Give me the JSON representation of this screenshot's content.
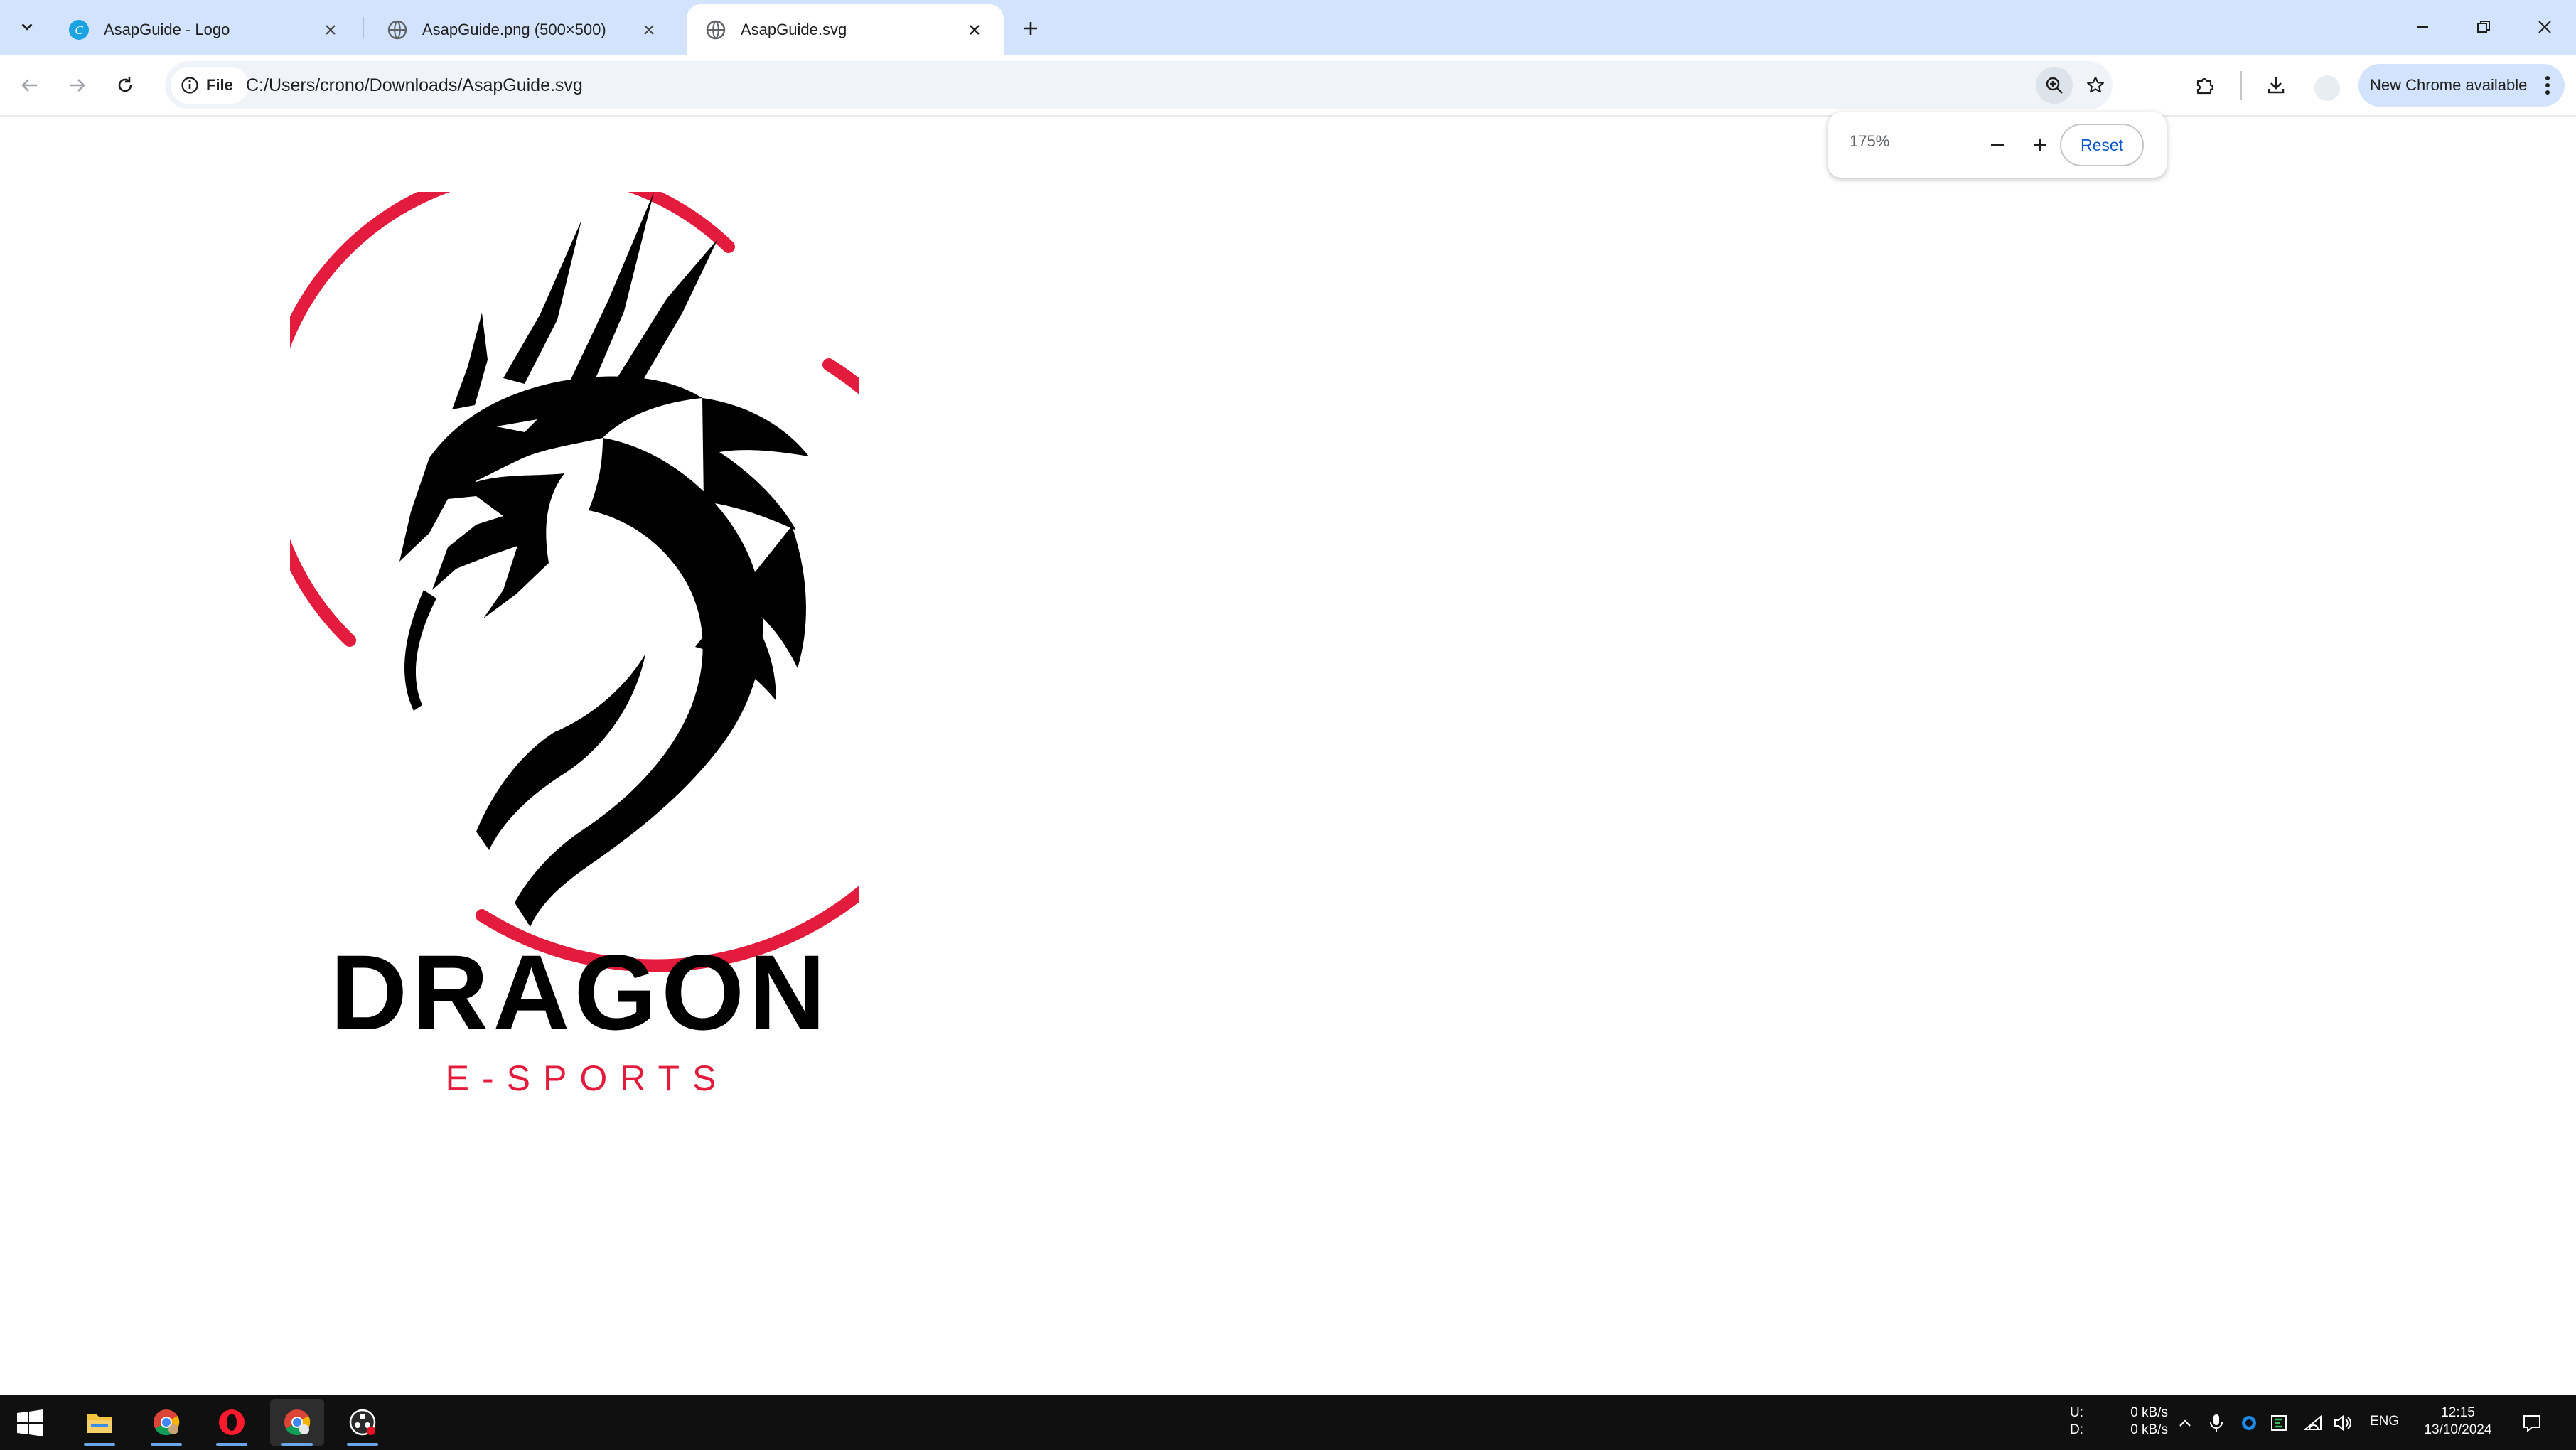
{
  "browser": {
    "tabs": [
      {
        "title": "AsapGuide - Logo",
        "favicon": "canva-icon",
        "active": false
      },
      {
        "title": "AsapGuide.png (500×500)",
        "favicon": "globe-icon",
        "active": false
      },
      {
        "title": "AsapGuide.svg",
        "favicon": "globe-icon",
        "active": true
      }
    ],
    "omnibox": {
      "chip_label": "File",
      "url": "C:/Users/crono/Downloads/AsapGuide.svg"
    },
    "update_label": "New Chrome available"
  },
  "zoom_popup": {
    "level": "175%",
    "reset_label": "Reset"
  },
  "logo": {
    "title": "DRAGON",
    "subtitle": "E-SPORTS",
    "colors": {
      "ring": "#e31b3c",
      "dragon": "#000000",
      "title": "#000000",
      "subtitle": "#e31b3c"
    }
  },
  "taskbar": {
    "apps": [
      "file-explorer-icon",
      "chrome-icon",
      "opera-icon",
      "chrome-profile-icon",
      "obs-icon"
    ],
    "net_upload_label": "U:",
    "net_download_label": "D:",
    "net_upload": "0 kB/s",
    "net_download": "0 kB/s",
    "language": "ENG",
    "time": "12:15",
    "date": "13/10/2024"
  }
}
